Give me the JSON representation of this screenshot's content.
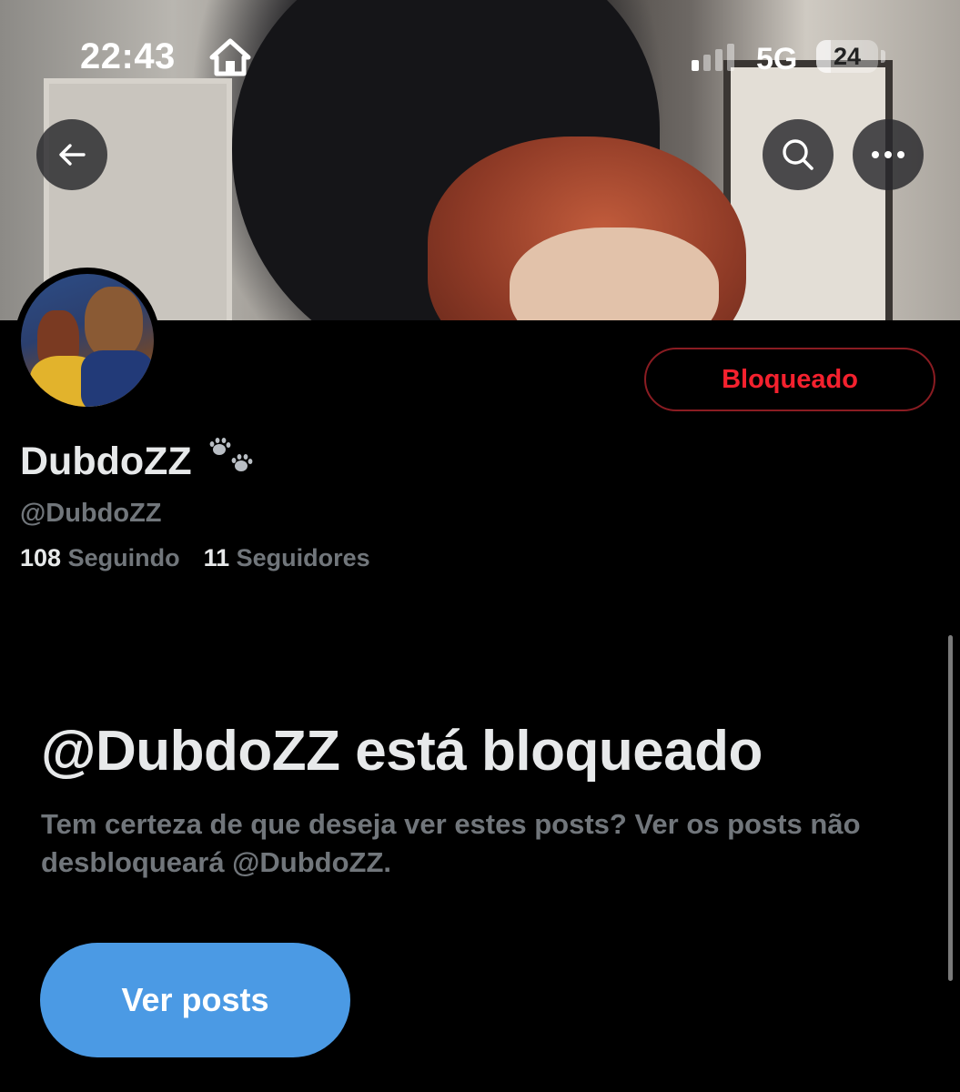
{
  "status_bar": {
    "time": "22:43",
    "home_icon": "house-icon",
    "network": "5G",
    "battery": "24",
    "battery_level": 0.24,
    "signal_bars_active": 1,
    "signal_bars_total": 4
  },
  "header": {
    "back_icon": "arrow-left-icon",
    "search_icon": "search-icon",
    "more_icon": "more-horizontal-icon"
  },
  "profile": {
    "display_name": "DubdoZZ",
    "name_emoji_icon": "paw-prints-icon",
    "handle": "@DubdoZZ",
    "following_count": "108",
    "following_label": "Seguindo",
    "followers_count": "11",
    "followers_label": "Seguidores",
    "blocked_button_label": "Bloqueado"
  },
  "blocked_notice": {
    "title": "@DubdoZZ está bloqueado",
    "description": "Tem certeza de que deseja ver estes posts? Ver os posts não desbloqueará @DubdoZZ.",
    "view_button_label": "Ver posts"
  },
  "colors": {
    "background": "#000000",
    "primary_text": "#e7e9ea",
    "secondary_text": "#71767b",
    "blocked_red": "#f4212e",
    "accent_blue": "#4b9ae4"
  }
}
